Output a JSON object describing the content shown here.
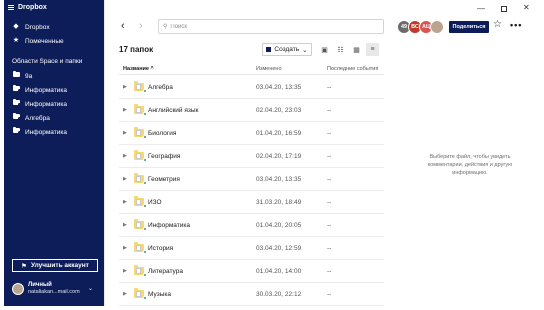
{
  "window": {
    "title": "Dropbox",
    "minimize_glyph": "—",
    "close_glyph": "✕"
  },
  "sidebar": {
    "nav": [
      {
        "label": "Dropbox",
        "icon": "dropbox-icon"
      },
      {
        "label": "Помеченные",
        "icon": "star-icon"
      }
    ],
    "section_title": "Области Space и папки",
    "folders": [
      {
        "label": "9a",
        "icon": "folder-icon"
      },
      {
        "label": "Информатика",
        "icon": "shared-folder-icon"
      },
      {
        "label": "Информатика",
        "icon": "shared-folder-icon"
      },
      {
        "label": "Алгебра",
        "icon": "shared-folder-icon"
      },
      {
        "label": "Информатика",
        "icon": "shared-folder-icon"
      }
    ],
    "upgrade_label": "Улучшить аккаунт",
    "account": {
      "name": "Личный",
      "email": "nataliakan...mail.com"
    }
  },
  "topbar": {
    "search_placeholder": "Поиск",
    "avatars": [
      {
        "initials": "49",
        "color": "#6b6b6b"
      },
      {
        "initials": "ВС",
        "color": "#c0392b"
      },
      {
        "initials": "АЦ",
        "color": "#d9534f"
      },
      {
        "initials": "",
        "color": "#b9a58f"
      }
    ],
    "share_label": "Поделиться"
  },
  "toolbar": {
    "count_label": "17 папок",
    "create_label": "Создать",
    "create_chevron": "⌄"
  },
  "table": {
    "columns": {
      "name": "Название ^",
      "modified": "Изменено",
      "activity": "Последние события"
    },
    "rows": [
      {
        "name": "Алгебра",
        "modified": "03.04.20, 13:35",
        "activity": "--"
      },
      {
        "name": "Английский язык",
        "modified": "02.04.20, 23:03",
        "activity": "--"
      },
      {
        "name": "Биология",
        "modified": "01.04.20, 16:59",
        "activity": "--"
      },
      {
        "name": "География",
        "modified": "02.04.20, 17:19",
        "activity": "--"
      },
      {
        "name": "Геометрия",
        "modified": "03.04.20, 13:35",
        "activity": "--"
      },
      {
        "name": "ИЗО",
        "modified": "31.03.20, 18:49",
        "activity": "--"
      },
      {
        "name": "Информатика",
        "modified": "01.04.20, 20:05",
        "activity": "--"
      },
      {
        "name": "История",
        "modified": "03.04.20, 12:59",
        "activity": "--"
      },
      {
        "name": "Литература",
        "modified": "01.04.20, 14:00",
        "activity": "--"
      },
      {
        "name": "Музыка",
        "modified": "30.03.20, 22:12",
        "activity": "--"
      }
    ]
  },
  "info_panel": {
    "text": "Выберите файл, чтобы увидеть комментарии, действия и другую информацию."
  }
}
